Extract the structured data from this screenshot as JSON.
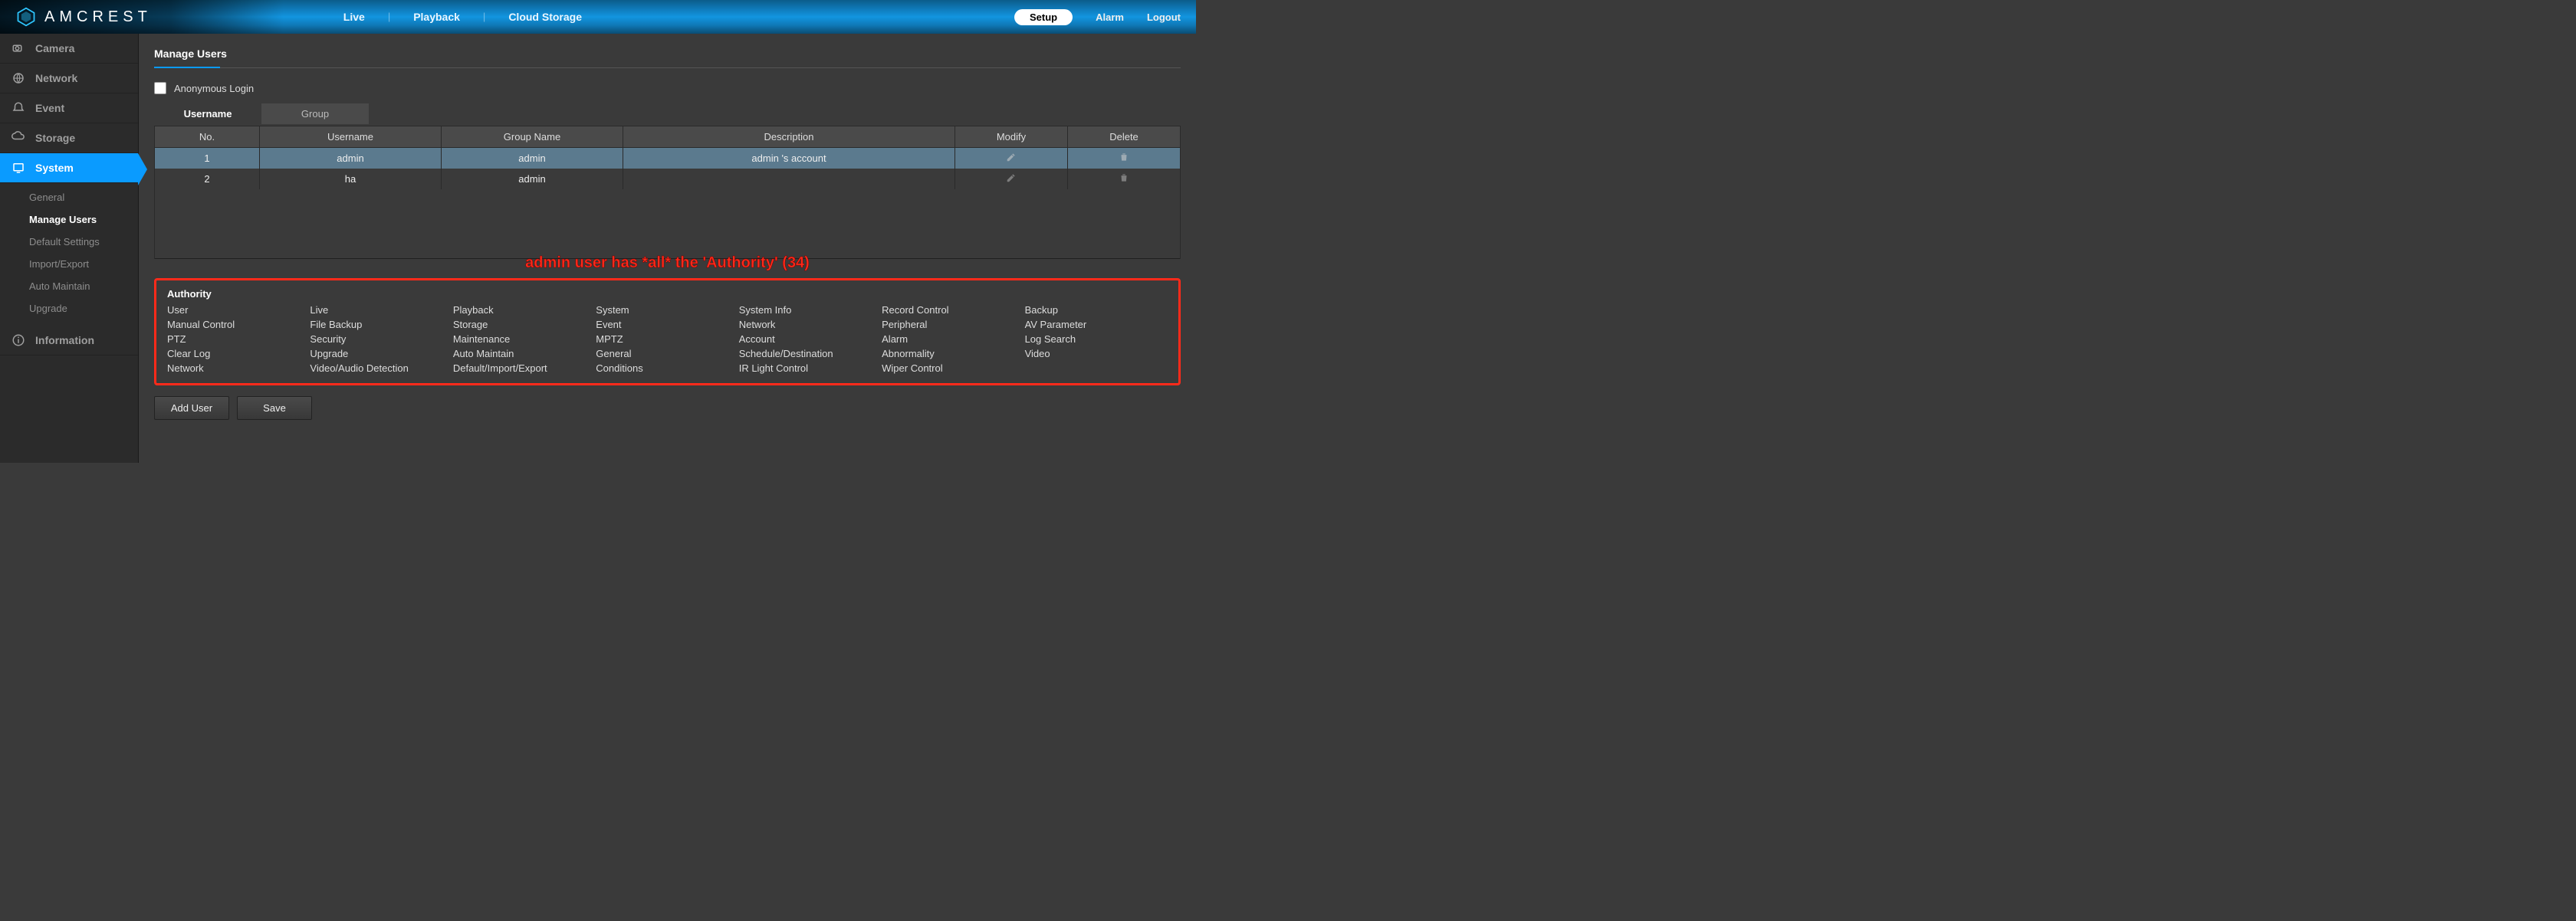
{
  "brand": "AMCREST",
  "nav": {
    "live": "Live",
    "playback": "Playback",
    "cloud": "Cloud Storage"
  },
  "topright": {
    "setup": "Setup",
    "alarm": "Alarm",
    "logout": "Logout"
  },
  "sidebar": {
    "items": [
      {
        "label": "Camera"
      },
      {
        "label": "Network"
      },
      {
        "label": "Event"
      },
      {
        "label": "Storage"
      },
      {
        "label": "System"
      },
      {
        "label": "Information"
      }
    ],
    "system_sub": [
      {
        "label": "General"
      },
      {
        "label": "Manage Users"
      },
      {
        "label": "Default Settings"
      },
      {
        "label": "Import/Export"
      },
      {
        "label": "Auto Maintain"
      },
      {
        "label": "Upgrade"
      }
    ]
  },
  "page": {
    "title": "Manage Users",
    "anonymous_label": "Anonymous Login",
    "subtabs": {
      "username": "Username",
      "group": "Group"
    },
    "columns": {
      "no": "No.",
      "username": "Username",
      "group": "Group Name",
      "description": "Description",
      "modify": "Modify",
      "delete": "Delete"
    },
    "rows": [
      {
        "no": "1",
        "username": "admin",
        "group": "admin",
        "description": "admin 's account"
      },
      {
        "no": "2",
        "username": "ha",
        "group": "admin",
        "description": ""
      }
    ],
    "annotation": "admin user has *all* the 'Authority' (34)",
    "authority_title": "Authority",
    "authority": [
      "User",
      "Live",
      "Playback",
      "System",
      "System Info",
      "Record Control",
      "Backup",
      "Manual Control",
      "File Backup",
      "Storage",
      "Event",
      "Network",
      "Peripheral",
      "AV Parameter",
      "PTZ",
      "Security",
      "Maintenance",
      "MPTZ",
      "Account",
      "Alarm",
      "Log Search",
      "Clear Log",
      "Upgrade",
      "Auto Maintain",
      "General",
      "Schedule/Destination",
      "Abnormality",
      "Video",
      "Network",
      "Video/Audio Detection",
      "Default/Import/Export",
      "Conditions",
      "IR Light Control",
      "Wiper Control"
    ],
    "buttons": {
      "add": "Add User",
      "save": "Save"
    }
  }
}
